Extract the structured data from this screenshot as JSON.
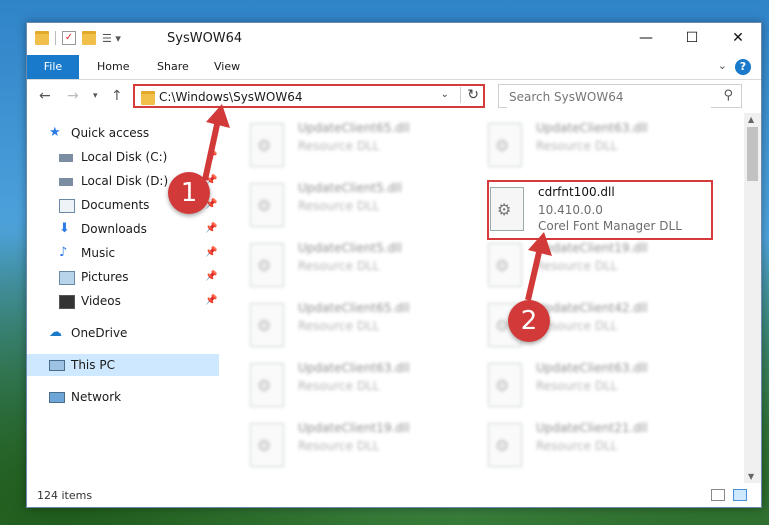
{
  "window": {
    "title": "SysWOW64",
    "minimize_icon": "minimize-icon",
    "maximize_icon": "maximize-icon",
    "close_icon": "close-icon"
  },
  "ribbon": {
    "tabs": [
      "File",
      "Home",
      "Share",
      "View"
    ],
    "help": "?"
  },
  "address": {
    "path": "C:\\Windows\\SysWOW64"
  },
  "search": {
    "placeholder": "Search SysWOW64"
  },
  "sidebar": {
    "items": [
      {
        "label": "Quick access",
        "icon": "star-icon"
      },
      {
        "label": "Local Disk (C:)",
        "icon": "drive-icon"
      },
      {
        "label": "Local Disk (D:)",
        "icon": "drive-icon"
      },
      {
        "label": "Documents",
        "icon": "documents-icon"
      },
      {
        "label": "Downloads",
        "icon": "download-icon"
      },
      {
        "label": "Music",
        "icon": "music-icon"
      },
      {
        "label": "Pictures",
        "icon": "pictures-icon"
      },
      {
        "label": "Videos",
        "icon": "videos-icon"
      },
      {
        "label": "OneDrive",
        "icon": "cloud-icon"
      },
      {
        "label": "This PC",
        "icon": "computer-icon"
      },
      {
        "label": "Network",
        "icon": "network-icon"
      }
    ]
  },
  "files": [
    {
      "name": "UpdateClient65.dll",
      "type": "Resource DLL"
    },
    {
      "name": "UpdateClient63.dll",
      "type": "Resource DLL"
    },
    {
      "name": "UpdateClient5.dll",
      "type": "Resource DLL"
    },
    {
      "name": "cdrfnt100.dll",
      "version": "10.410.0.0",
      "type": "Corel Font Manager DLL"
    },
    {
      "name": "UpdateClient5.dll",
      "type": "Resource DLL"
    },
    {
      "name": "UpdateClient19.dll",
      "type": "Resource DLL"
    },
    {
      "name": "UpdateClient65.dll",
      "type": "Resource DLL"
    },
    {
      "name": "UpdateClient42.dll",
      "type": "Resource DLL"
    },
    {
      "name": "UpdateClient63.dll",
      "type": "Resource DLL"
    },
    {
      "name": "UpdateClient63.dll",
      "type": "Resource DLL"
    },
    {
      "name": "UpdateClient19.dll",
      "type": "Resource DLL"
    },
    {
      "name": "UpdateClient21.dll",
      "type": "Resource DLL"
    }
  ],
  "status": {
    "item_count": "124 items"
  },
  "annotations": [
    {
      "number": "1"
    },
    {
      "number": "2"
    }
  ],
  "colors": {
    "highlight": "#d63b3b",
    "file_tab": "#1979ca"
  }
}
